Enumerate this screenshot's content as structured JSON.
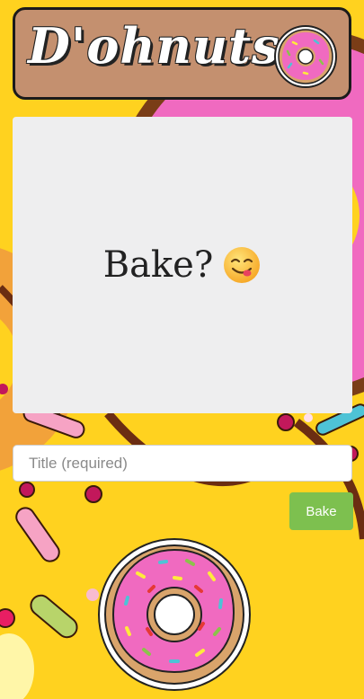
{
  "header": {
    "brand": "D'ohnuts"
  },
  "preview": {
    "text": "Bake?",
    "emoji": "yum-face-icon"
  },
  "form": {
    "title_placeholder": "Title (required)",
    "title_value": "",
    "bake_label": "Bake"
  },
  "colors": {
    "background": "#ffd21f",
    "header_bg": "#c4906f",
    "card_bg": "#eeeeef",
    "button": "#7dc04f",
    "frosting": "#f06ac0",
    "dough": "#d9a46b"
  }
}
